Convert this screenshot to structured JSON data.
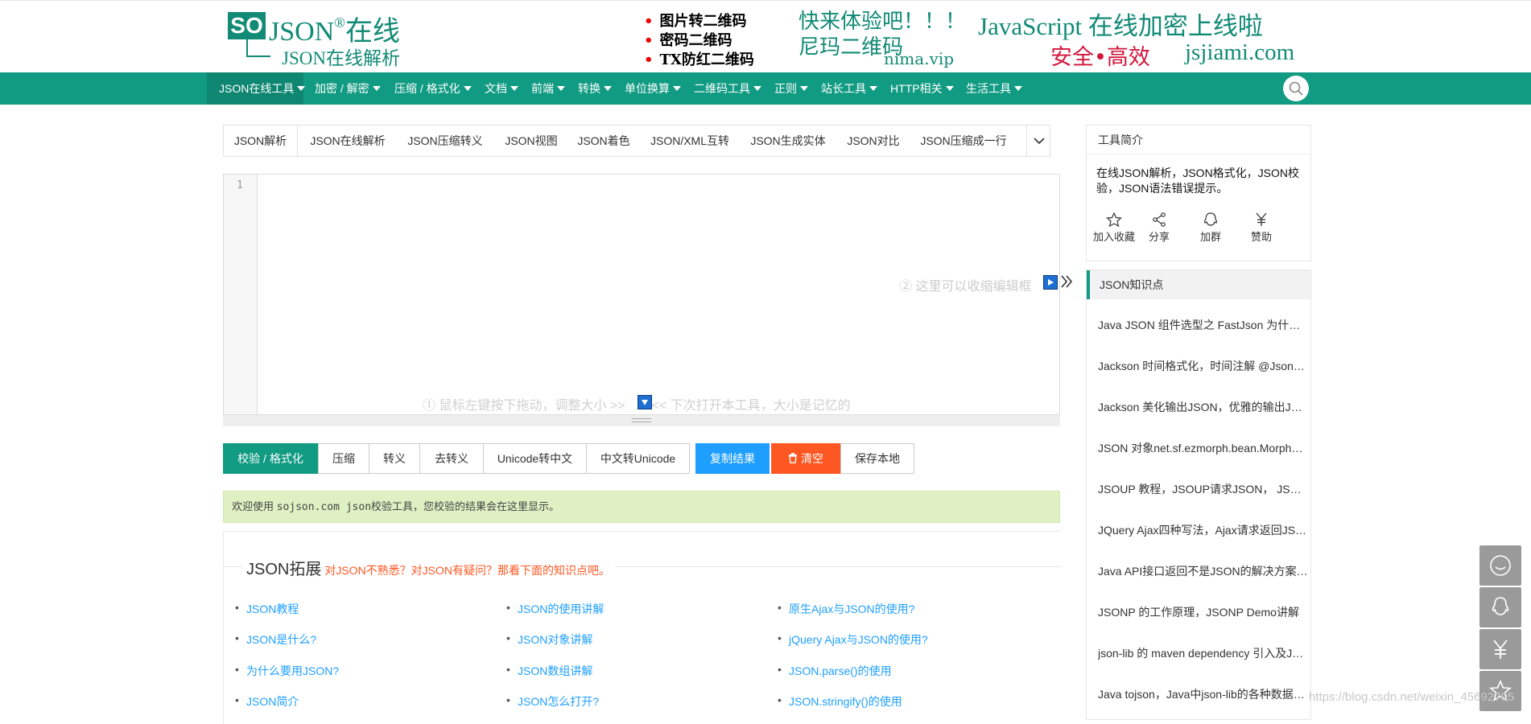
{
  "header": {
    "logo_box": "SO",
    "logo_json": "JSON",
    "logo_reg": "®",
    "logo_online": "在线",
    "logo_sub": "JSON在线解析",
    "ad_lines": [
      "图片转二维码",
      "密码二维码",
      "TX防红二维码"
    ],
    "ad_try": "快来体验吧！！！",
    "ad_nima_cn": "尼玛二维码",
    "ad_nima_url": "nima.vip",
    "ad_js": "JavaScript 在线加密上线啦",
    "ad_safe": "安全•高效",
    "ad_js_url": "jsjiami.com"
  },
  "nav": {
    "items": [
      "JSON在线工具",
      "加密 / 解密",
      "压缩 / 格式化",
      "文档",
      "前端",
      "转换",
      "单位换算",
      "二维码工具",
      "正则",
      "站长工具",
      "HTTP相关",
      "生活工具"
    ]
  },
  "tabs": [
    "JSON解析",
    "JSON在线解析",
    "JSON压缩转义",
    "JSON视图",
    "JSON着色",
    "JSON/XML互转",
    "JSON生成实体",
    "JSON对比",
    "JSON压缩成一行"
  ],
  "editor": {
    "line_number": "1",
    "hint_right": "② 这里可以收缩编辑框",
    "hint_bottom_left": "① 鼠标左键按下拖动，调整大小 >>",
    "hint_bottom_right": "<< 下次打开本工具，大小是记忆的"
  },
  "buttons": {
    "format": "校验 / 格式化",
    "compress": "压缩",
    "escape": "转义",
    "unescape": "去转义",
    "unicode_cn": "Unicode转中文",
    "cn_unicode": "中文转Unicode",
    "copy": "复制结果",
    "clear": "清空",
    "save": "保存本地"
  },
  "result": {
    "prefix": "欢迎使用 ",
    "code": "sojson.com json",
    "suffix": "校验工具，您校验的结果会在这里显示。"
  },
  "expand": {
    "title": "JSON拓展",
    "subtitle": "对JSON不熟悉？对JSON有疑问？那看下面的知识点吧。",
    "col1": [
      "JSON教程",
      "JSON是什么?",
      "为什么要用JSON?",
      "JSON简介"
    ],
    "col2": [
      "JSON的使用讲解",
      "JSON对象讲解",
      "JSON数组讲解",
      "JSON怎么打开?"
    ],
    "col3": [
      "原生Ajax与JSON的使用?",
      "jQuery Ajax与JSON的使用?",
      "JSON.parse()的使用",
      "JSON.stringify()的使用"
    ]
  },
  "sidebar": {
    "intro_title": "工具简介",
    "intro_desc": "在线JSON解析，JSON格式化，JSON校验，JSON语法错误提示。",
    "actions": [
      "加入收藏",
      "分享",
      "加群",
      "赞助"
    ],
    "knowledge_title": "JSON知识点",
    "articles": [
      "Java JSON 组件选型之 FastJson 为什么…",
      "Jackson 时间格式化，时间注解 @Json…",
      "Jackson 美化输出JSON，优雅的输出JS…",
      "JSON 对象net.sf.ezmorph.bean.Morph…",
      "JSOUP 教程，JSOUP请求JSON， JSO…",
      "JQuery Ajax四种写法，Ajax请求返回JS…",
      "Java API接口返回不是JSON的解决方案…",
      "JSONP 的工作原理，JSONP Demo讲解",
      "json-lib 的 maven dependency 引入及J…",
      "Java tojson，Java中json-lib的各种数据…"
    ]
  },
  "watermark": "https://blog.csdn.net/weixin_45692705",
  "colors": {
    "brand": "#119b83",
    "link": "#1e9fff",
    "danger": "#ff5722",
    "result_bg": "#dff0c3"
  }
}
